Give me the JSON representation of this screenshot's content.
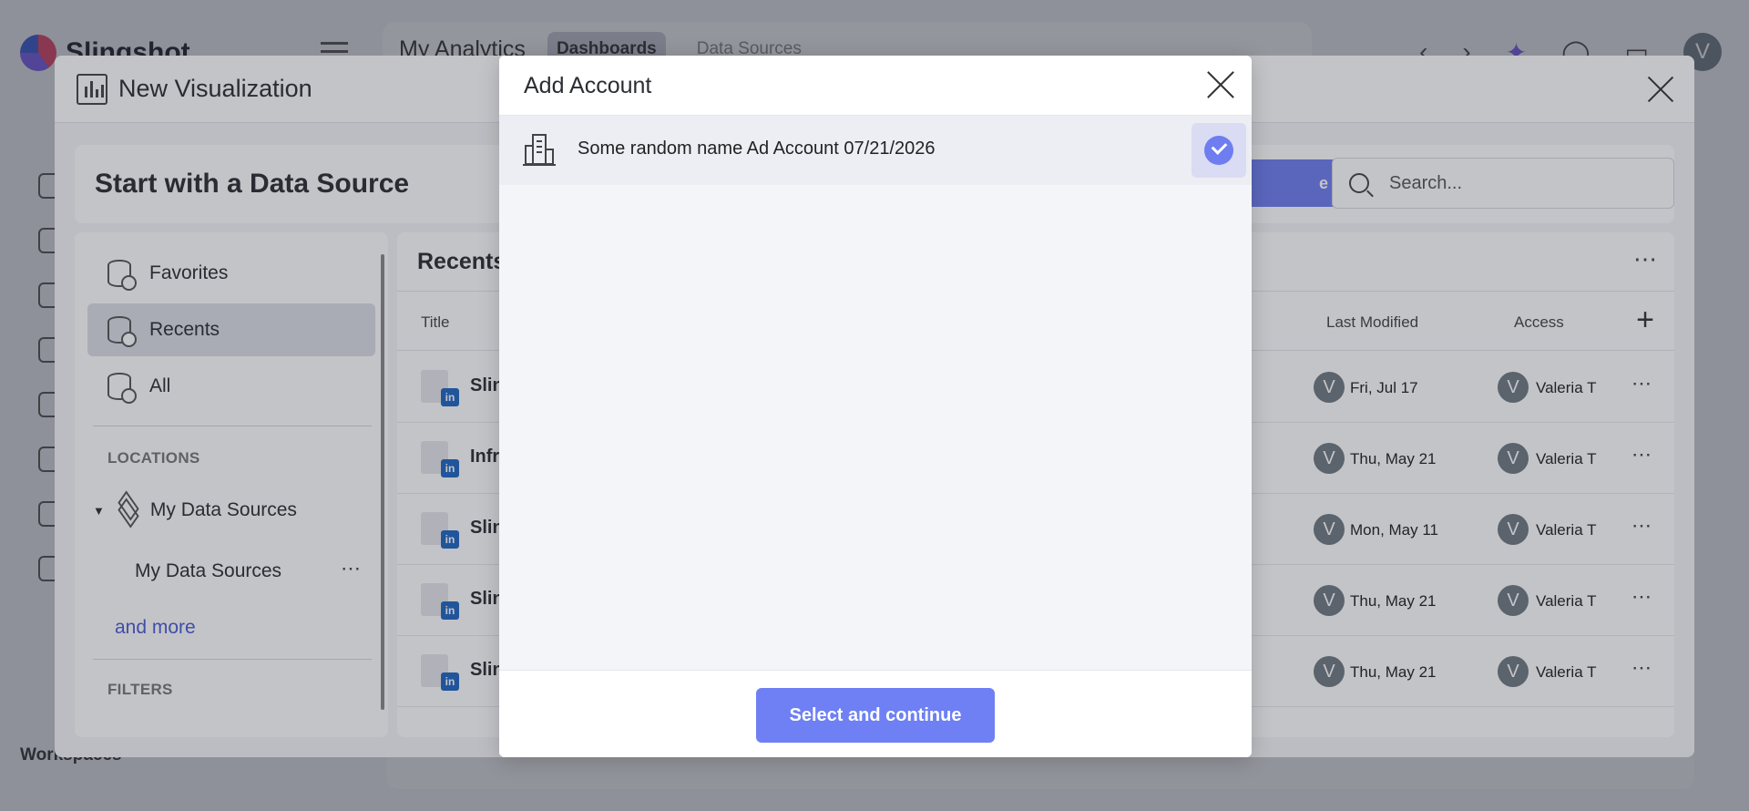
{
  "app": {
    "logo_text": "Slingshot",
    "header_title": "My Analytics",
    "tabs": [
      {
        "label": "Dashboards",
        "active": true
      },
      {
        "label": "Data Sources",
        "active": false
      }
    ],
    "user_initial": "V",
    "workspaces_label": "Workspaces"
  },
  "new_visualization": {
    "title": "New Visualization",
    "band_title": "Start with a Data Source",
    "cta_label": "e",
    "search_placeholder": "Search...",
    "sidebar": {
      "items": [
        {
          "label": "Favorites",
          "active": false
        },
        {
          "label": "Recents",
          "active": true
        },
        {
          "label": "All",
          "active": false
        }
      ],
      "locations_heading": "LOCATIONS",
      "my_data_sources_group": "My Data Sources",
      "my_data_sources_child": "My Data Sources",
      "and_more": "and more",
      "filters_heading": "FILTERS"
    },
    "recents": {
      "title": "Recents",
      "columns": {
        "title": "Title",
        "last_modified": "Last Modified",
        "access": "Access"
      },
      "rows": [
        {
          "name": "Slin",
          "modified": "Fri, Jul 17",
          "access": "Valeria T",
          "initial": "V"
        },
        {
          "name": "Infr",
          "modified": "Thu, May 21",
          "access": "Valeria T",
          "initial": "V"
        },
        {
          "name": "Slin",
          "modified": "Mon, May 11",
          "access": "Valeria T",
          "initial": "V"
        },
        {
          "name": "Slin",
          "modified": "Thu, May 21",
          "access": "Valeria T",
          "initial": "V"
        },
        {
          "name": "Slin",
          "modified": "Thu, May 21",
          "access": "Valeria T",
          "initial": "V"
        }
      ]
    }
  },
  "add_account": {
    "title": "Add Account",
    "account": {
      "name": "Some random name Ad Account 07/21/2026",
      "selected": true
    },
    "select_button": "Select and continue"
  },
  "colors": {
    "accent": "#6e80f4",
    "linkedin": "#1f66c2"
  },
  "icons": [
    "close-icon",
    "check-icon",
    "building-icon",
    "search-icon",
    "database-icon",
    "layers-icon",
    "linkedin-icon"
  ]
}
